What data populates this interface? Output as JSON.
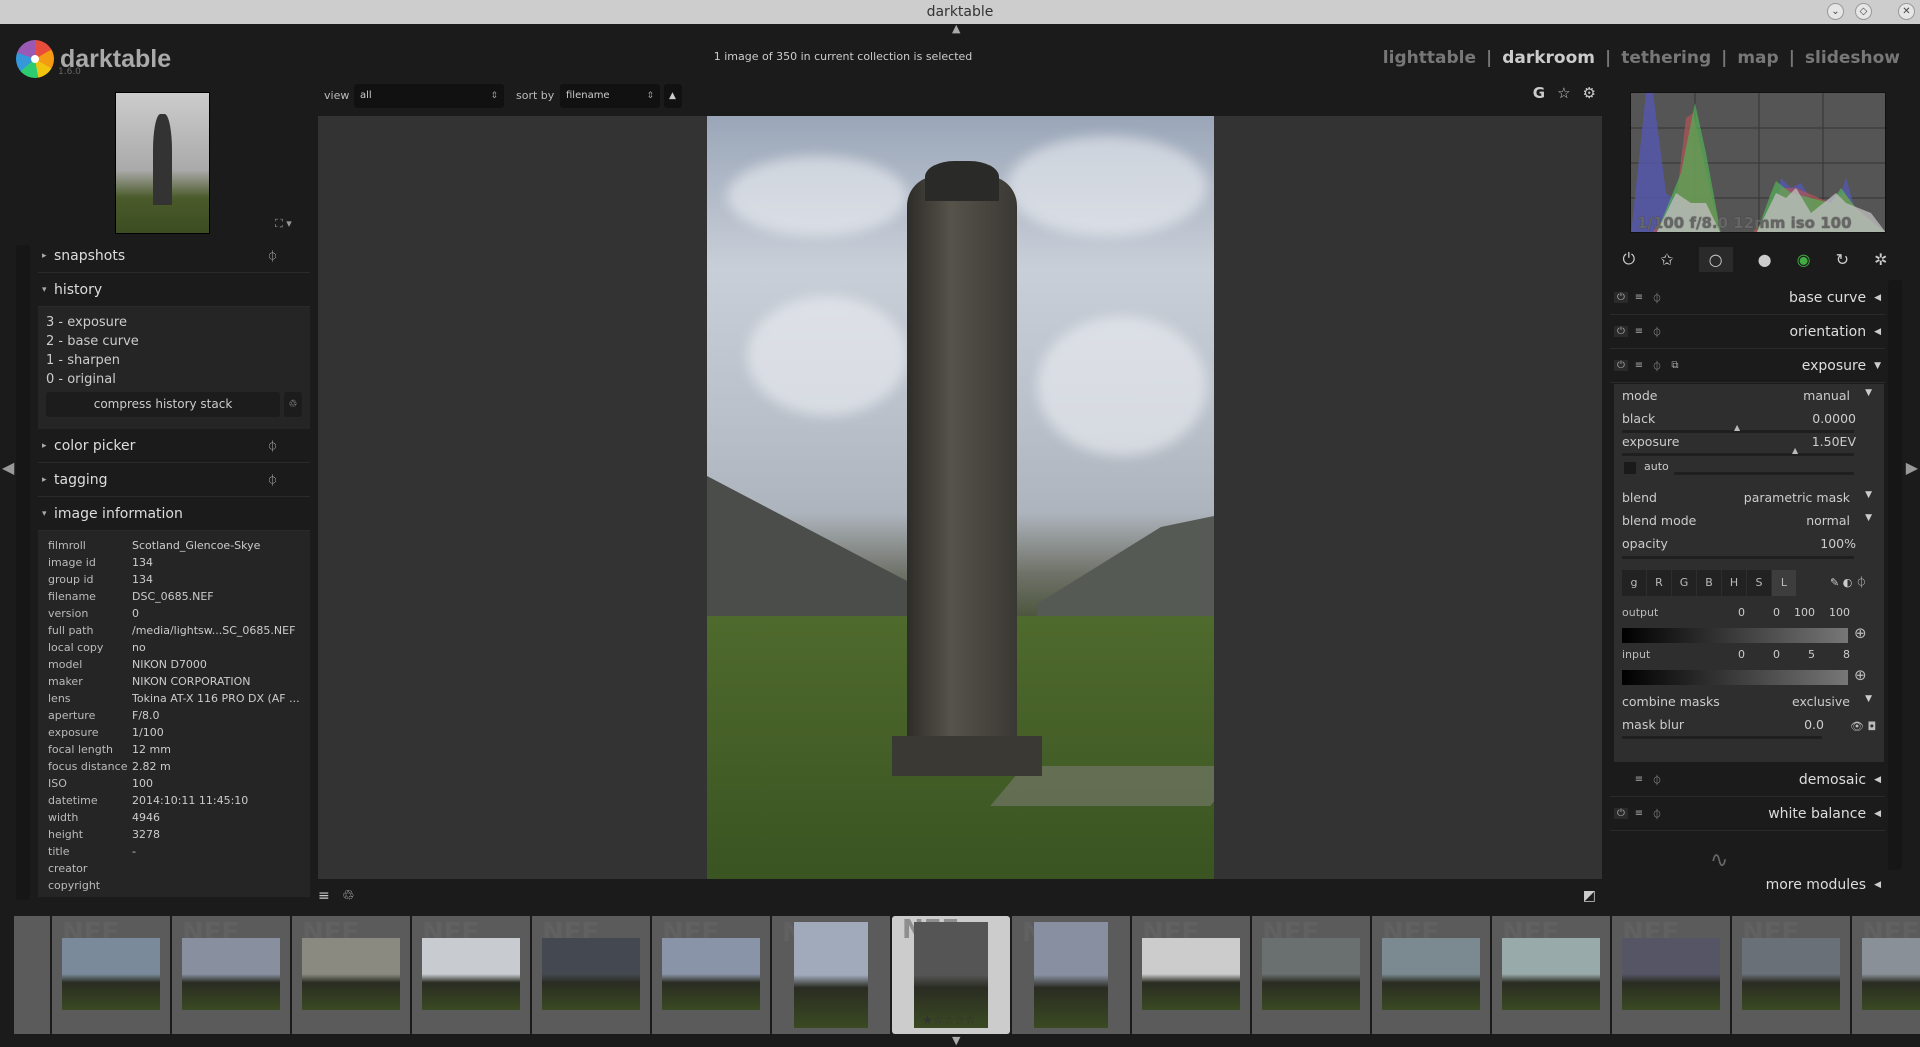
{
  "window": {
    "title": "darktable"
  },
  "logo": {
    "name": "darktable",
    "version": "1.6.0"
  },
  "status": "1 image of 350 in current collection is selected",
  "views": [
    {
      "label": "lighttable"
    },
    {
      "label": "darkroom",
      "active": true
    },
    {
      "label": "tethering"
    },
    {
      "label": "map"
    },
    {
      "label": "slideshow"
    }
  ],
  "view_sep": "|",
  "toolbar": {
    "view_label": "view",
    "view_value": "all",
    "sort_label": "sort by",
    "sort_value": "filename",
    "grouping": "G"
  },
  "left": {
    "snapshots": "snapshots",
    "history": {
      "title": "history",
      "items": [
        "3 - exposure",
        "2 - base curve",
        "1 - sharpen",
        "0 - original"
      ],
      "compress": "compress history stack"
    },
    "color_picker": "color picker",
    "tagging": "tagging",
    "image_information": {
      "title": "image information",
      "rows": [
        [
          "filmroll",
          "Scotland_Glencoe-Skye"
        ],
        [
          "image id",
          "134"
        ],
        [
          "group id",
          "134"
        ],
        [
          "filename",
          "DSC_0685.NEF"
        ],
        [
          "version",
          "0"
        ],
        [
          "full path",
          "/media/lightsw...SC_0685.NEF"
        ],
        [
          "local copy",
          "no"
        ],
        [
          "model",
          "NIKON D7000"
        ],
        [
          "maker",
          "NIKON CORPORATION"
        ],
        [
          "lens",
          "Tokina AT-X 116 PRO DX (AF ..."
        ],
        [
          "aperture",
          "F/8.0"
        ],
        [
          "exposure",
          "1/100"
        ],
        [
          "focal length",
          "12 mm"
        ],
        [
          "focus distance",
          "2.82 m"
        ],
        [
          "ISO",
          "100"
        ],
        [
          "datetime",
          "2014:10:11 11:45:10"
        ],
        [
          "width",
          "4946"
        ],
        [
          "height",
          "3278"
        ],
        [
          "title",
          "-"
        ],
        [
          "creator",
          ""
        ],
        [
          "copyright",
          ""
        ]
      ]
    }
  },
  "histogram": {
    "label": "1/100 f/8.0 12mm iso 100"
  },
  "right": {
    "modules": {
      "base_curve": "base curve",
      "orientation": "orientation",
      "exposure": "exposure",
      "demosaic": "demosaic",
      "white_balance": "white balance",
      "more": "more modules"
    },
    "exposure": {
      "mode_label": "mode",
      "mode": "manual",
      "black_label": "black",
      "black": "0.0000",
      "black_pos": 0.5,
      "exposure_label": "exposure",
      "exposure": "1.50EV",
      "exposure_pos": 0.75,
      "auto_label": "auto",
      "blend_label": "blend",
      "blend": "parametric mask",
      "blend_mode_label": "blend mode",
      "blend_mode": "normal",
      "opacity_label": "opacity",
      "opacity": "100%",
      "channels": [
        "g",
        "R",
        "G",
        "B",
        "H",
        "S",
        "L"
      ],
      "active_channel": "L",
      "output_label": "output",
      "output_vals": [
        "0",
        "0",
        "100",
        "100"
      ],
      "input_label": "input",
      "input_vals": [
        "0",
        "0",
        "5",
        "8"
      ],
      "combine_label": "combine masks",
      "combine": "exclusive",
      "mask_blur_label": "mask blur",
      "mask_blur": "0.0"
    }
  },
  "filmstrip": {
    "selected_index": 8,
    "selected_rating": 1,
    "count_visible": 16,
    "placeholder": "NEF"
  }
}
